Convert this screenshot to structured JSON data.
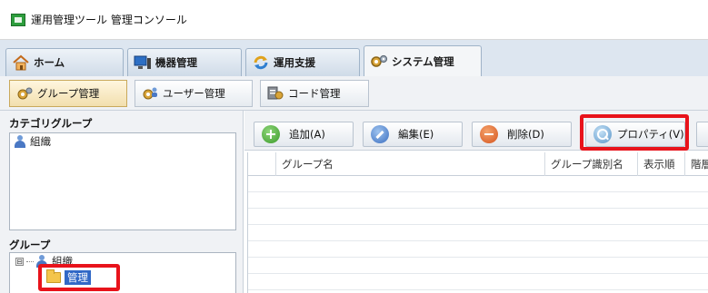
{
  "window": {
    "title": "運用管理ツール 管理コンソール"
  },
  "tabs": [
    {
      "label": "ホーム",
      "icon": "home-icon"
    },
    {
      "label": "機器管理",
      "icon": "monitor-icon"
    },
    {
      "label": "運用支援",
      "icon": "sync-icon"
    },
    {
      "label": "システム管理",
      "icon": "gears-icon",
      "active": true
    }
  ],
  "subtoolbar": [
    {
      "label": "グループ管理",
      "icon": "group-gears-icon",
      "active": true
    },
    {
      "label": "ユーザー管理",
      "icon": "user-gears-icon"
    },
    {
      "label": "コード管理",
      "icon": "code-icon"
    }
  ],
  "left": {
    "category_title": "カテゴリグループ",
    "category_items": [
      {
        "label": "組織",
        "icon": "person-icon"
      }
    ],
    "group_title": "グループ",
    "group_tree": {
      "root": {
        "label": "組織",
        "expander": "⊟"
      },
      "child": {
        "label": "管理",
        "selected": true
      }
    }
  },
  "actions": [
    {
      "label": "追加(A)",
      "icon": "add-icon"
    },
    {
      "label": "編集(E)",
      "icon": "edit-icon"
    },
    {
      "label": "削除(D)",
      "icon": "delete-icon"
    },
    {
      "label": "プロパティ(V)",
      "icon": "properties-icon",
      "highlighted": true
    }
  ],
  "table": {
    "columns": [
      "グループ名",
      "グループ識別名",
      "表示順",
      "階層"
    ],
    "rows": []
  },
  "colors": {
    "highlight": "#e8131b",
    "selection": "#3168c6",
    "tab_bar": "#dde6f0"
  }
}
